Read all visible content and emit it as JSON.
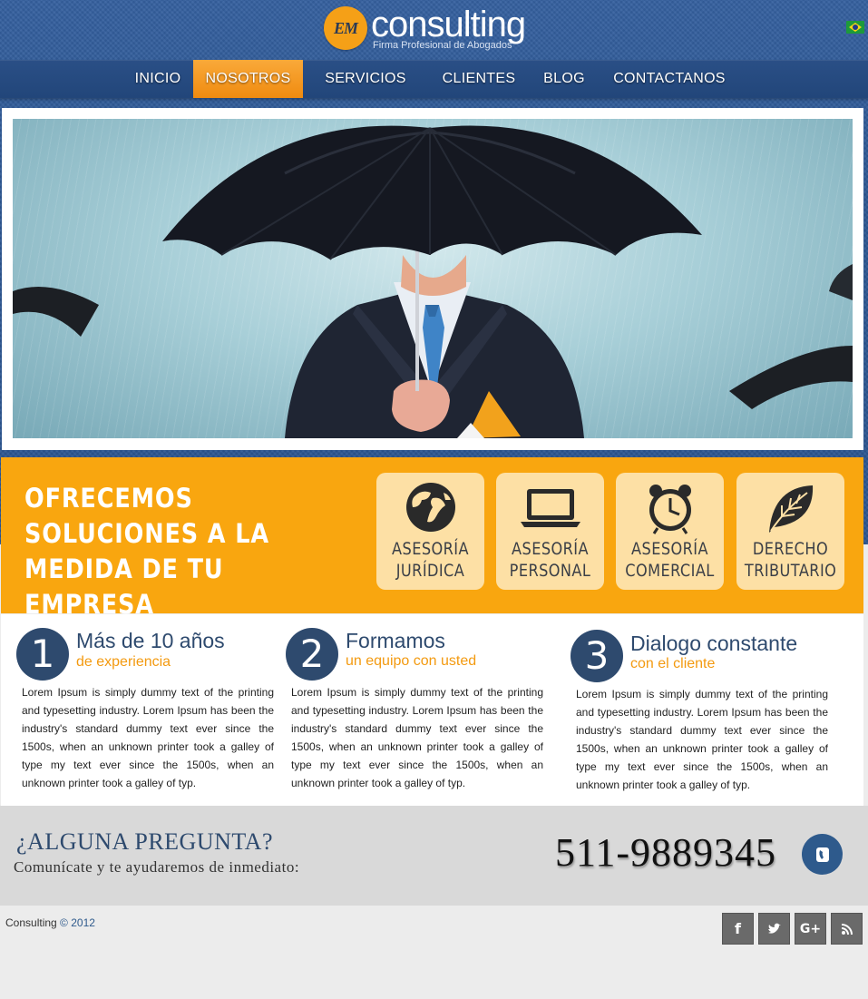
{
  "header": {
    "logo_mark": "EM",
    "logo_word": "consulting",
    "logo_tagline": "Firma Profesional de Abogados"
  },
  "nav": {
    "items": [
      {
        "label": "INICIO",
        "active": false
      },
      {
        "label": "NOSOTROS",
        "active": true
      },
      {
        "label": "SERVICIOS",
        "active": false
      },
      {
        "label": "CLIENTES",
        "active": false
      },
      {
        "label": "BLOG",
        "active": false
      },
      {
        "label": "CONTACTANOS",
        "active": false
      }
    ]
  },
  "promo": {
    "headline_lines": [
      "OFRECEMOS",
      "SOLUCIONES A LA",
      "MEDIDA DE TU EMPRESA"
    ],
    "services": [
      {
        "line1": "ASESORÍA",
        "line2": "JURÍDICA",
        "icon": "globe-icon"
      },
      {
        "line1": "ASESORÍA",
        "line2": "PERSONAL",
        "icon": "laptop-icon"
      },
      {
        "line1": "ASESORÍA",
        "line2": "COMERCIAL",
        "icon": "alarm-clock-icon"
      },
      {
        "line1": "DERECHO",
        "line2": "TRIBUTARIO",
        "icon": "leaf-icon"
      }
    ]
  },
  "features": [
    {
      "number": "1",
      "title": "Más de 10 años",
      "subtitle": "de experiencia",
      "text": "Lorem Ipsum is simply dummy text of the printing and typesetting industry. Lorem Ipsum has been the industry's standard dummy text ever since the 1500s, when an unknown printer took a galley of type my text ever since the 1500s, when an unknown printer took a galley of typ."
    },
    {
      "number": "2",
      "title": "Formamos",
      "subtitle": "un equipo con usted",
      "text": "Lorem Ipsum is simply dummy text of the printing and typesetting industry. Lorem Ipsum has been the industry's standard dummy text ever since the 1500s, when an unknown printer took a galley of type my text ever since the 1500s, when an unknown printer took a galley of typ."
    },
    {
      "number": "3",
      "title": "Dialogo constante",
      "subtitle": "con el cliente",
      "text": "Lorem Ipsum is simply dummy text of the printing and typesetting industry. Lorem Ipsum has been the industry's standard dummy text ever since the 1500s, when an unknown printer took a galley of type my text ever since the 1500s, when an unknown printer took a galley of typ."
    }
  ],
  "contact": {
    "title": "¿ALGUNA PREGUNTA?",
    "subtitle": "Comunícate y te ayudaremos de inmediato:",
    "phone": "511-9889345"
  },
  "footer": {
    "brand": "Consulting",
    "copyright_symbol": "©",
    "year": "2012",
    "social": [
      {
        "name": "facebook",
        "glyph": "f"
      },
      {
        "name": "twitter",
        "glyph": "t"
      },
      {
        "name": "google-plus",
        "glyph": "G+"
      },
      {
        "name": "rss",
        "glyph": ""
      }
    ]
  },
  "colors": {
    "brand_orange": "#f9a60f",
    "navy": "#2e4a6e",
    "denim_blue": "#2c5691"
  }
}
